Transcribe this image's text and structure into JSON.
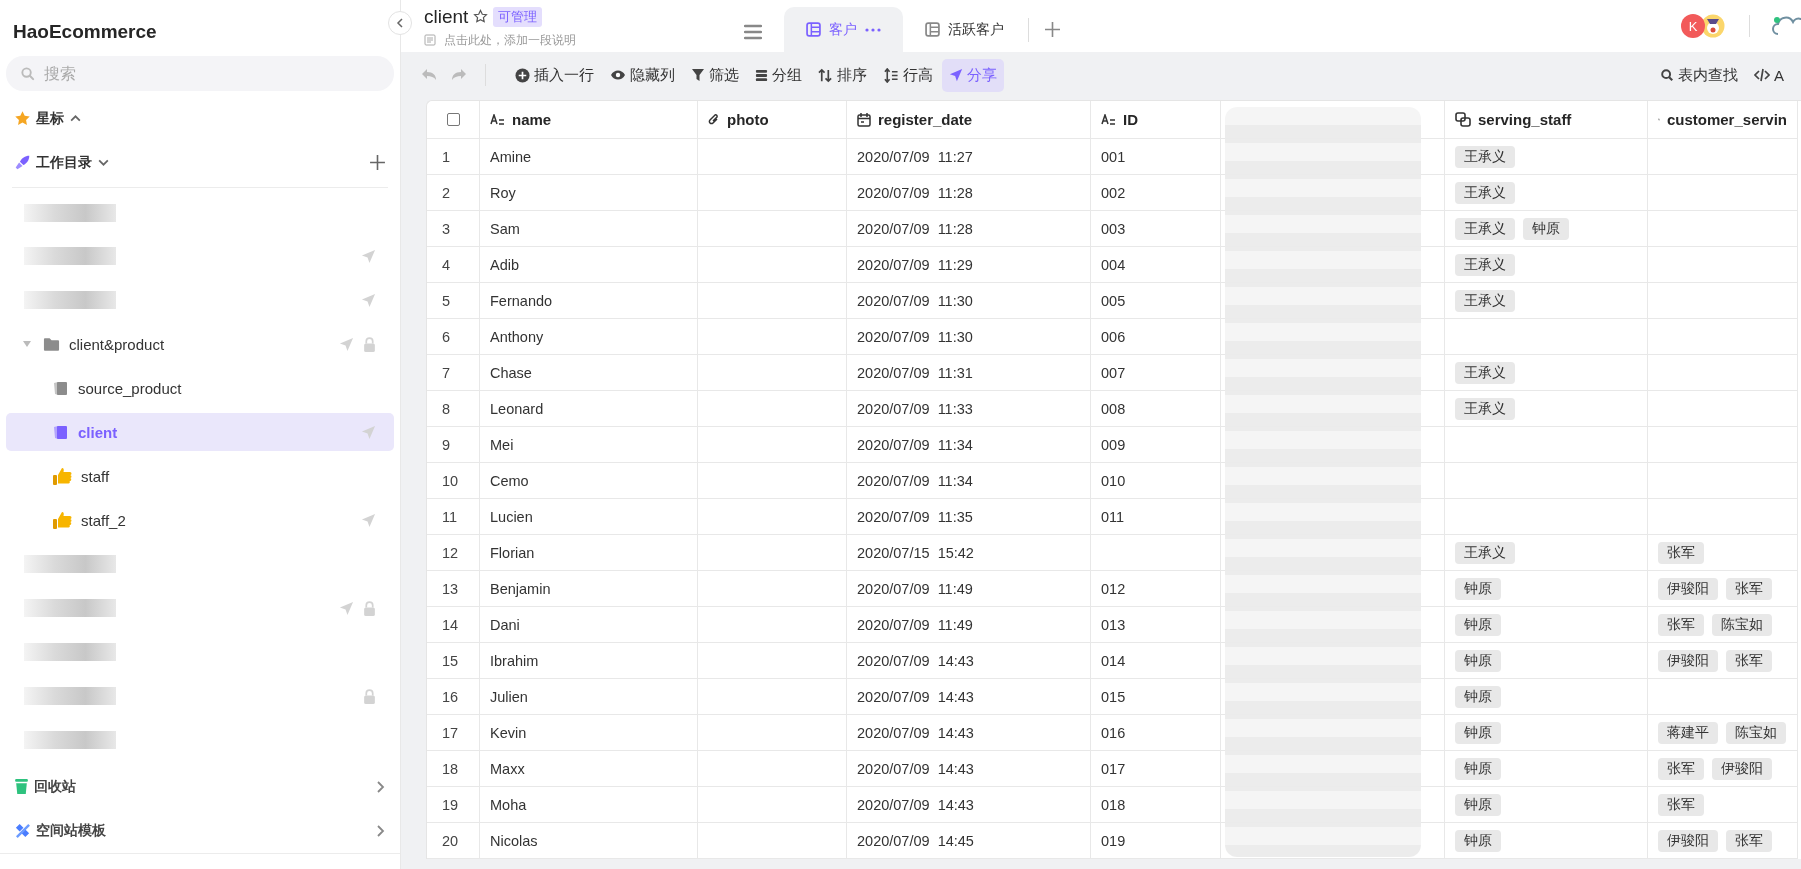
{
  "sidebar": {
    "title": "HaoEcommerce",
    "search": {
      "placeholder": "搜索"
    },
    "starred": {
      "label": "星标",
      "expanded": true
    },
    "workspace": {
      "label": "工作目录",
      "expanded": false
    },
    "items": [
      {
        "kind": "redacted",
        "selected": false,
        "shared": false,
        "locked": false
      },
      {
        "kind": "redacted",
        "selected": false,
        "shared": true,
        "locked": false
      },
      {
        "kind": "redacted",
        "selected": false,
        "shared": true,
        "locked": false
      },
      {
        "kind": "folder",
        "label": "client&product",
        "selected": false,
        "shared": true,
        "locked": true,
        "expanded": true,
        "children": [
          {
            "kind": "sheet",
            "label": "source_product",
            "selected": false,
            "shared": false,
            "locked": false
          },
          {
            "kind": "sheet",
            "label": "client",
            "selected": true,
            "shared": true,
            "locked": false
          },
          {
            "kind": "form",
            "label": "staff",
            "selected": false,
            "shared": false,
            "locked": false
          },
          {
            "kind": "form",
            "label": "staff_2",
            "selected": false,
            "shared": true,
            "locked": false
          }
        ]
      },
      {
        "kind": "redacted",
        "selected": false,
        "shared": false,
        "locked": false
      },
      {
        "kind": "redacted",
        "selected": false,
        "shared": true,
        "locked": true
      },
      {
        "kind": "redacted",
        "selected": false,
        "shared": false,
        "locked": false
      },
      {
        "kind": "redacted",
        "selected": false,
        "shared": false,
        "locked": true
      },
      {
        "kind": "redacted",
        "selected": false,
        "shared": false,
        "locked": false
      }
    ],
    "footer": [
      {
        "kind": "trash",
        "label": "回收站"
      },
      {
        "kind": "templates",
        "label": "空间站模板"
      }
    ]
  },
  "header": {
    "title": "client",
    "badge": "可管理",
    "description": "点击此处，添加一段说明",
    "tabs": [
      {
        "label": "客户",
        "selected": true
      },
      {
        "label": "活跃客户",
        "selected": false
      }
    ],
    "avatars": [
      {
        "kind": "letter",
        "text": "K"
      },
      {
        "kind": "picture"
      }
    ]
  },
  "toolbar": {
    "buttons": [
      {
        "kind": "insert",
        "label": "插入一行",
        "active": false
      },
      {
        "kind": "hide",
        "label": "隐藏列",
        "active": false
      },
      {
        "kind": "filter",
        "label": "筛选",
        "active": false
      },
      {
        "kind": "group",
        "label": "分组",
        "active": false
      },
      {
        "kind": "sort",
        "label": "排序",
        "active": false
      },
      {
        "kind": "height",
        "label": "行高",
        "active": false
      },
      {
        "kind": "share",
        "label": "分享",
        "active": true
      }
    ],
    "right": [
      {
        "kind": "search",
        "label": "表内查找"
      },
      {
        "kind": "code",
        "label": "A"
      }
    ]
  },
  "table": {
    "select_all": {
      "checked": false
    },
    "columns": [
      {
        "kind": "text",
        "label": "name"
      },
      {
        "kind": "attachment",
        "label": "photo"
      },
      {
        "kind": "date",
        "label": "register_date"
      },
      {
        "kind": "text",
        "label": "ID"
      },
      {
        "kind": "redacted"
      },
      {
        "kind": "link",
        "label": "serving_staff"
      },
      {
        "kind": "link",
        "label": "customer_servin"
      }
    ],
    "rows": [
      {
        "number": "1",
        "name": "Amine",
        "register_date": "2020/07/09  11:27",
        "id": "001",
        "serving_staff": [
          "王承义"
        ],
        "customer_serving": []
      },
      {
        "number": "2",
        "name": "Roy",
        "register_date": "2020/07/09  11:28",
        "id": "002",
        "serving_staff": [
          "王承义"
        ],
        "customer_serving": []
      },
      {
        "number": "3",
        "name": "Sam",
        "register_date": "2020/07/09  11:28",
        "id": "003",
        "serving_staff": [
          "王承义",
          "钟原"
        ],
        "customer_serving": []
      },
      {
        "number": "4",
        "name": "Adib",
        "register_date": "2020/07/09  11:29",
        "id": "004",
        "serving_staff": [
          "王承义"
        ],
        "customer_serving": []
      },
      {
        "number": "5",
        "name": "Fernando",
        "register_date": "2020/07/09  11:30",
        "id": "005",
        "serving_staff": [
          "王承义"
        ],
        "customer_serving": []
      },
      {
        "number": "6",
        "name": "Anthony",
        "register_date": "2020/07/09  11:30",
        "id": "006",
        "serving_staff": [],
        "customer_serving": []
      },
      {
        "number": "7",
        "name": "Chase",
        "register_date": "2020/07/09  11:31",
        "id": "007",
        "serving_staff": [
          "王承义"
        ],
        "customer_serving": []
      },
      {
        "number": "8",
        "name": "Leonard",
        "register_date": "2020/07/09  11:33",
        "id": "008",
        "serving_staff": [
          "王承义"
        ],
        "customer_serving": []
      },
      {
        "number": "9",
        "name": "Mei",
        "register_date": "2020/07/09  11:34",
        "id": "009",
        "serving_staff": [],
        "customer_serving": []
      },
      {
        "number": "10",
        "name": "Cemo",
        "register_date": "2020/07/09  11:34",
        "id": "010",
        "serving_staff": [],
        "customer_serving": []
      },
      {
        "number": "11",
        "name": "Lucien",
        "register_date": "2020/07/09  11:35",
        "id": "011",
        "serving_staff": [],
        "customer_serving": []
      },
      {
        "number": "12",
        "name": "Florian",
        "register_date": "2020/07/15  15:42",
        "serving_staff": [
          "王承义"
        ],
        "customer_serving": [
          "张军"
        ]
      },
      {
        "number": "13",
        "name": "Benjamin",
        "register_date": "2020/07/09  11:49",
        "id": "012",
        "serving_staff": [
          "钟原"
        ],
        "customer_serving": [
          "伊骏阳",
          "张军"
        ]
      },
      {
        "number": "14",
        "name": "Dani",
        "register_date": "2020/07/09  11:49",
        "id": "013",
        "serving_staff": [
          "钟原"
        ],
        "customer_serving": [
          "张军",
          "陈宝如"
        ]
      },
      {
        "number": "15",
        "name": "Ibrahim",
        "register_date": "2020/07/09  14:43",
        "id": "014",
        "serving_staff": [
          "钟原"
        ],
        "customer_serving": [
          "伊骏阳",
          "张军"
        ]
      },
      {
        "number": "16",
        "name": "Julien",
        "register_date": "2020/07/09  14:43",
        "id": "015",
        "serving_staff": [
          "钟原"
        ],
        "customer_serving": []
      },
      {
        "number": "17",
        "name": "Kevin",
        "register_date": "2020/07/09  14:43",
        "id": "016",
        "serving_staff": [
          "钟原"
        ],
        "customer_serving": [
          "蒋建平",
          "陈宝如"
        ]
      },
      {
        "number": "18",
        "name": "Maxx",
        "register_date": "2020/07/09  14:43",
        "id": "017",
        "serving_staff": [
          "钟原"
        ],
        "customer_serving": [
          "张军",
          "伊骏阳"
        ]
      },
      {
        "number": "19",
        "name": "Moha",
        "register_date": "2020/07/09  14:43",
        "id": "018",
        "serving_staff": [
          "钟原"
        ],
        "customer_serving": [
          "张军"
        ]
      },
      {
        "number": "20",
        "name": "Nicolas",
        "register_date": "2020/07/09  14:45",
        "id": "019",
        "serving_staff": [
          "钟原"
        ],
        "customer_serving": [
          "伊骏阳",
          "张军"
        ]
      }
    ]
  }
}
